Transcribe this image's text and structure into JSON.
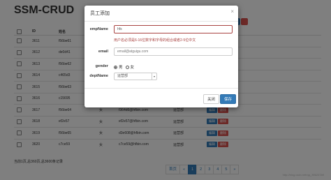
{
  "page": {
    "title": "SSM-CRUD"
  },
  "table": {
    "headers": [
      "",
      "ID",
      "姓名",
      "",
      "",
      "",
      ""
    ],
    "rows": [
      {
        "id": "3611",
        "name": "f56be61",
        "gender": "",
        "email": "",
        "dept": ""
      },
      {
        "id": "3612",
        "name": "de0d41",
        "gender": "",
        "email": "",
        "dept": ""
      },
      {
        "id": "3613",
        "name": "f56be62",
        "gender": "",
        "email": "",
        "dept": ""
      },
      {
        "id": "3614",
        "name": "c465d3",
        "gender": "",
        "email": "",
        "dept": ""
      },
      {
        "id": "3615",
        "name": "f56be63",
        "gender": "",
        "email": "",
        "dept": ""
      },
      {
        "id": "3616",
        "name": "c15695",
        "gender": "",
        "email": "",
        "dept": ""
      },
      {
        "id": "3617",
        "name": "f56be64",
        "gender": "女",
        "email": "f364d6@hfbin.com",
        "dept": "运营部"
      },
      {
        "id": "3618",
        "name": "ef2e57",
        "gender": "女",
        "email": "ef2e57@hfbin.com",
        "dept": "运营部"
      },
      {
        "id": "3619",
        "name": "f56be65",
        "gender": "女",
        "email": "d3e608@hfbin.com",
        "dept": "运营部"
      },
      {
        "id": "3620",
        "name": "c7ce59",
        "gender": "女",
        "email": "c7ce59@hfbin.com",
        "dept": "运营部"
      }
    ],
    "edit_label": "编辑",
    "delete_label": "删除"
  },
  "footer": {
    "info": "当前1页,总360页,总3600条记录"
  },
  "pagination": {
    "items": [
      "首页",
      "«",
      "1",
      "2",
      "3",
      "4",
      "5",
      "»"
    ],
    "active": "1"
  },
  "watermark": "http://blog.csdn.net/qq_39624789",
  "modal": {
    "title": "员工添加",
    "close_icon": "×",
    "fields": {
      "empname_label": "empName",
      "empname_value": "hfs",
      "empname_error": "用户名必须是6-16位数字和字母的组合或者2-5位中文",
      "email_label": "email",
      "email_placeholder": "email@atguigu.com",
      "gender_label": "gender",
      "gender_male": "男",
      "gender_female": "女",
      "dept_label": "deptName",
      "dept_value": "运营部"
    },
    "close_button": "关闭",
    "save_button": "保存"
  },
  "colors": {
    "primary": "#337ab7",
    "danger": "#d9534f",
    "error": "#a94442"
  }
}
